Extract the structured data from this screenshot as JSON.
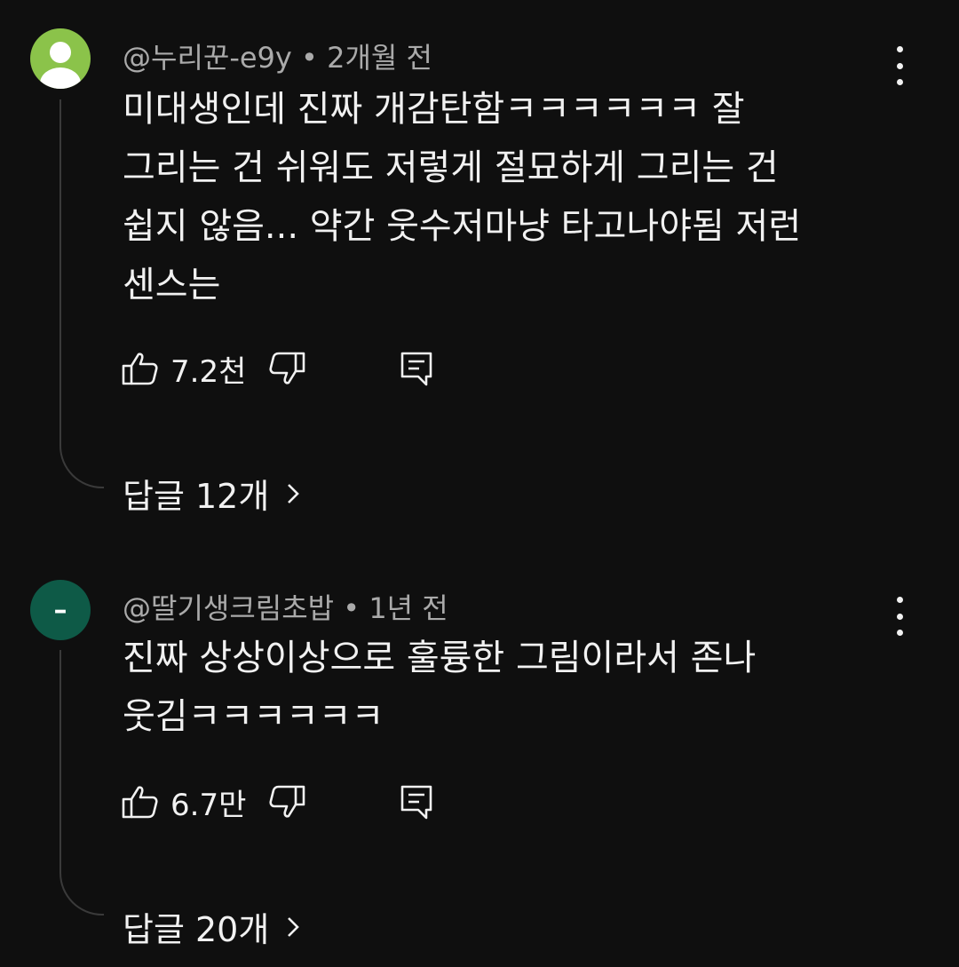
{
  "comments": [
    {
      "handle": "@누리꾼-e9y",
      "separator": "•",
      "time": "2개월 전",
      "avatar_icon": "default-user-avatar",
      "avatar_color": "#8bc34a",
      "lines": [
        "미대생인데 진짜 개감탄함ㅋㅋㅋㅋㅋㅋ 잘",
        "그리는 건 쉬워도 저렇게 절묘하게 그리는 건",
        "쉽지 않음... 약간 웃수저마냥 타고나야됨 저런",
        "센스는"
      ],
      "likes": "7.2천",
      "replies_label": "답글 12개"
    },
    {
      "handle": "@딸기생크림초밥",
      "separator": "•",
      "time": "1년 전",
      "avatar_icon": "dash-letter-avatar",
      "avatar_text": "–",
      "avatar_color": "#0e5a47",
      "lines": [
        "진짜 상상이상으로 훌륭한 그림이라서 존나",
        "웃김ㅋㅋㅋㅋㅋㅋ"
      ],
      "likes": "6.7만",
      "replies_label": "답글 20개"
    }
  ]
}
